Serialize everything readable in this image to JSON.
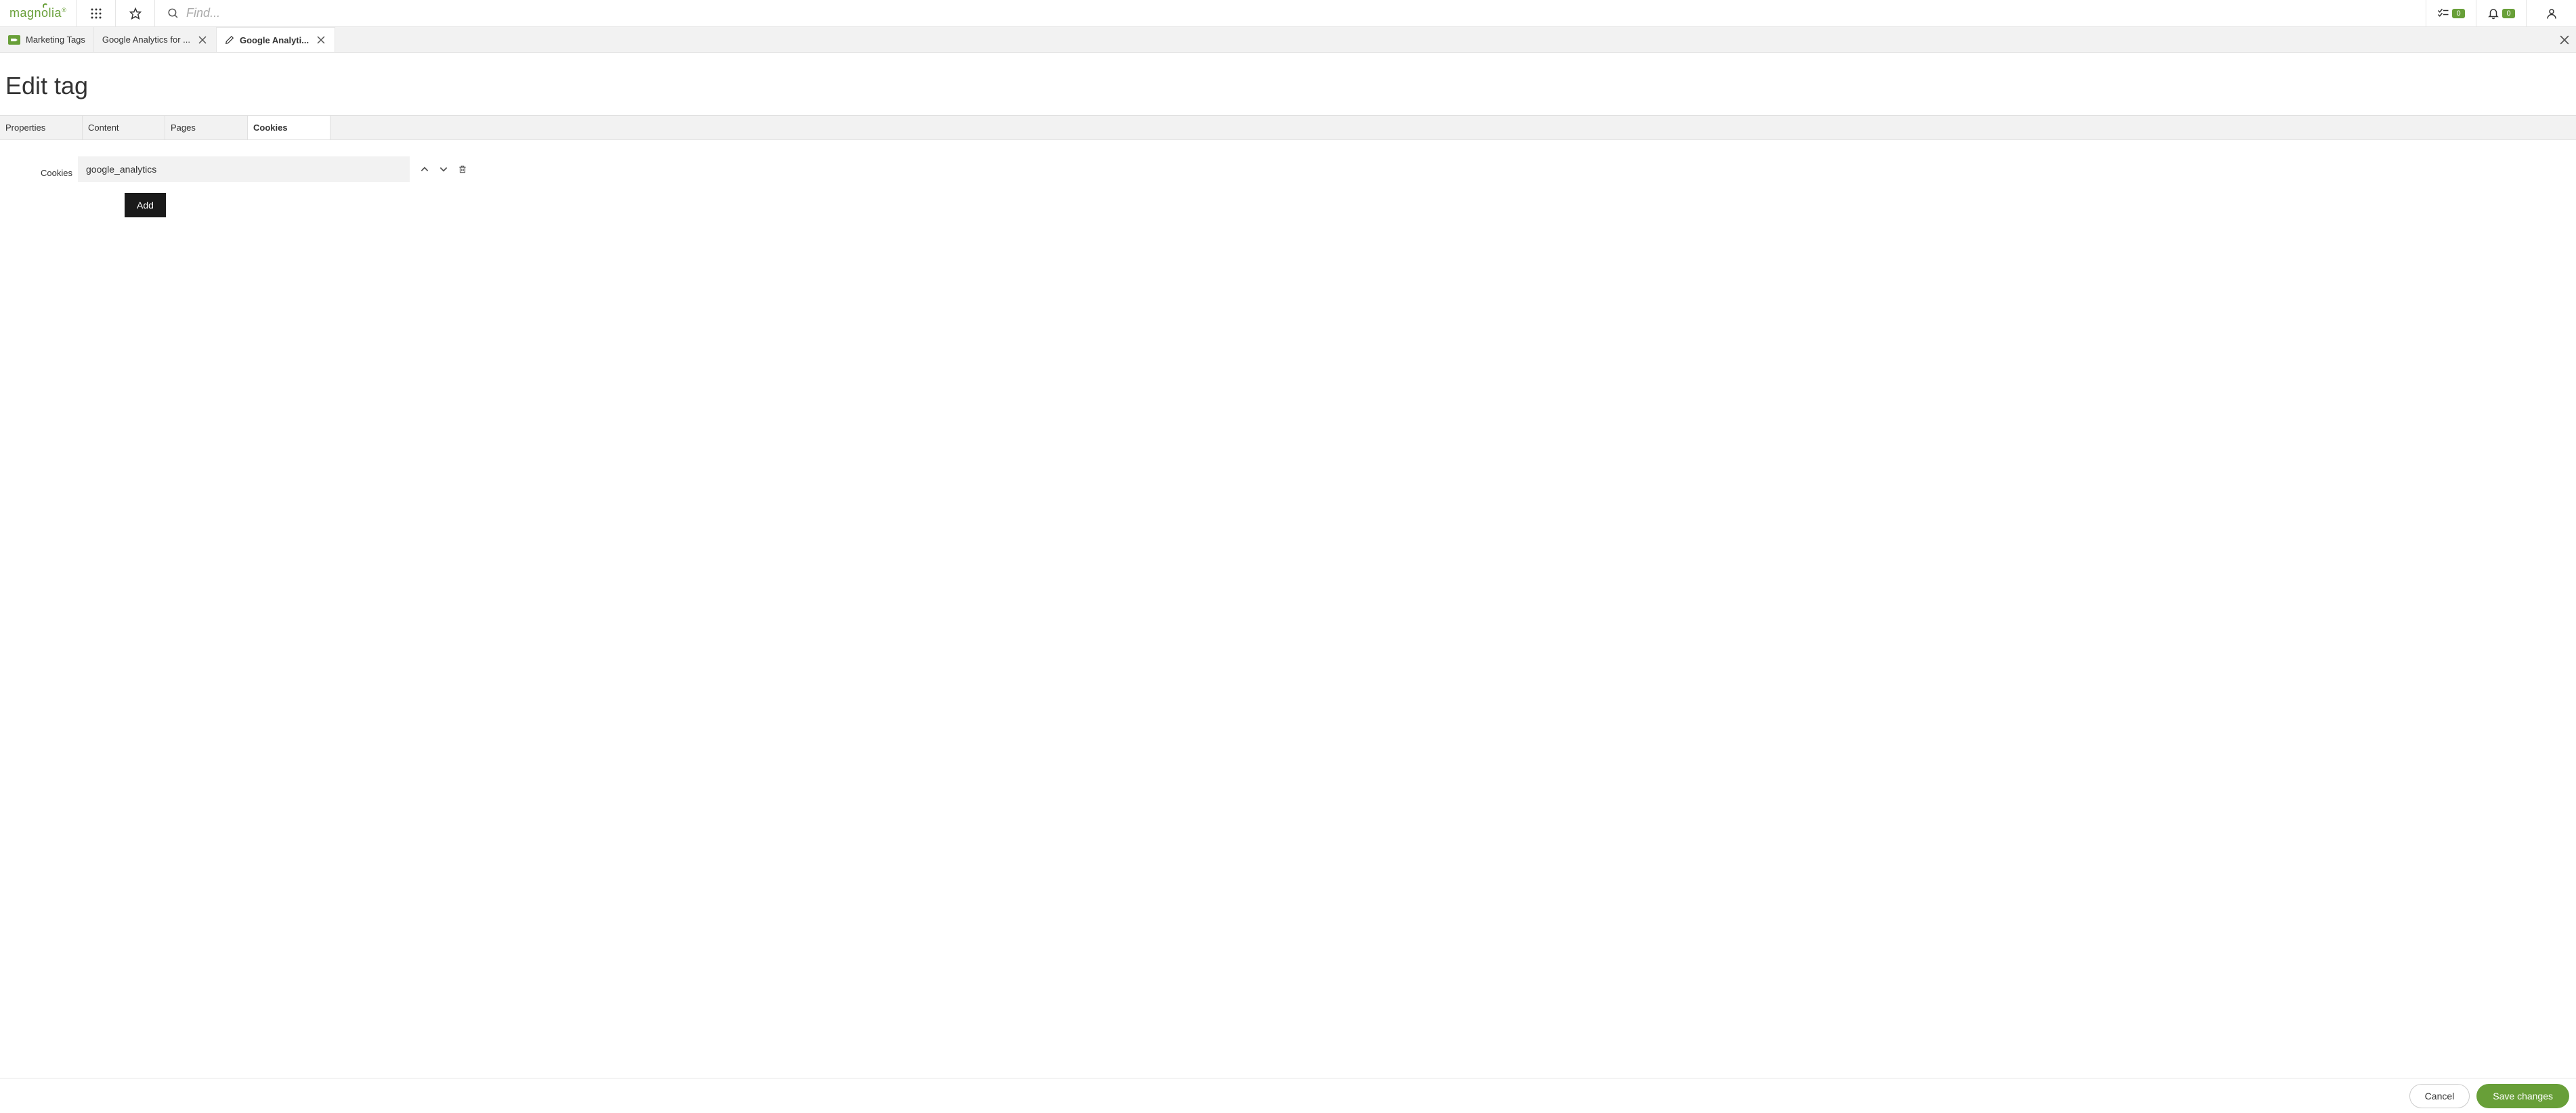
{
  "header": {
    "logo": "magnolia",
    "search_placeholder": "Find...",
    "tasks_badge": "0",
    "notifications_badge": "0"
  },
  "breadcrumbs": {
    "items": [
      {
        "label": "Marketing Tags",
        "closable": false,
        "icon": "tag"
      },
      {
        "label": "Google Analytics for ...",
        "closable": true,
        "icon": null
      },
      {
        "label": "Google Analyti...",
        "closable": true,
        "icon": "pencil",
        "active": true
      }
    ]
  },
  "page": {
    "title": "Edit tag"
  },
  "subtabs": {
    "items": [
      {
        "label": "Properties"
      },
      {
        "label": "Content"
      },
      {
        "label": "Pages"
      },
      {
        "label": "Cookies",
        "active": true
      }
    ]
  },
  "form": {
    "cookies_label": "Cookies",
    "fields": [
      {
        "value": "google_analytics"
      }
    ],
    "add_label": "Add"
  },
  "footer": {
    "cancel_label": "Cancel",
    "save_label": "Save changes"
  }
}
